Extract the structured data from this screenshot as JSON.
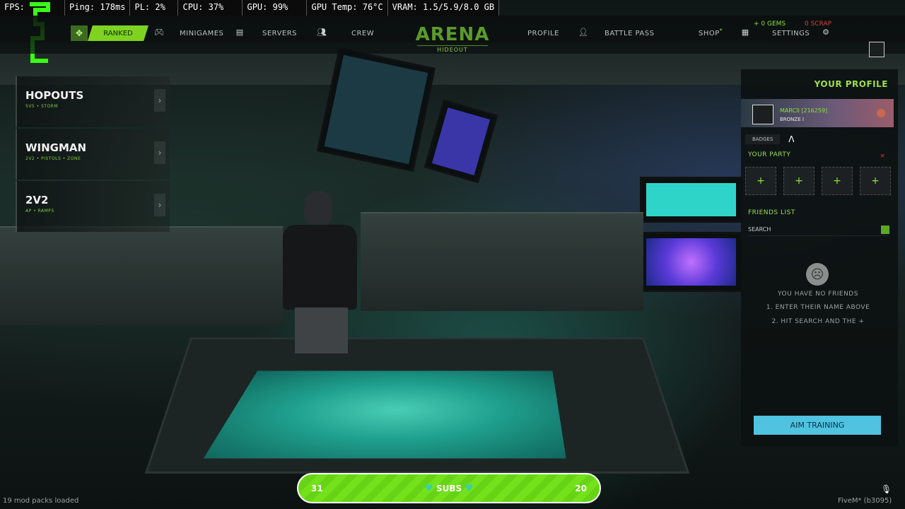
{
  "perf": {
    "fps": "FPS:",
    "ping": "Ping: 178ms",
    "pl": "PL: 2%",
    "cpu": "CPU: 37%",
    "gpu": "GPU: 99%",
    "gpu_temp": "GPU Temp: 76°C",
    "vram": "VRAM: 1.5/5.9/8.0 GB"
  },
  "nav": {
    "ranked": "RANKED",
    "minigames": "MINIGAMES",
    "servers": "SERVERS",
    "crew": "CREW",
    "profile": "PROFILE",
    "battle_pass": "BATTLE PASS",
    "shop": "SHOP",
    "shop_marker": "*",
    "settings": "SETTINGS"
  },
  "logo": {
    "title": "ARENA",
    "subtitle": "HIDEOUT"
  },
  "currency": {
    "gems": "+ 0 GEMS",
    "scrap": "0 SCRAP",
    "gems_color": "#8be33d",
    "scrap_color": "#c44"
  },
  "modes": [
    {
      "name": "HOPOUTS",
      "tags": "5V5 • STORM"
    },
    {
      "name": "WINGMAN",
      "tags": "2V2 • PISTOLS • ZONE"
    },
    {
      "name": "2V2",
      "tags": "AP • RAMPS"
    }
  ],
  "profile_panel": {
    "title": "YOUR PROFILE",
    "player_name": "MARCII [216259]",
    "rank": "BRONZE I",
    "badges_label": "BADGES",
    "party_title": "YOUR PARTY",
    "party_close": "×",
    "party_slots": [
      "+",
      "+",
      "+",
      "+"
    ],
    "friends_title": "FRIENDS LIST",
    "search_placeholder": "SEARCH",
    "empty_line1": "YOU HAVE NO FRIENDS",
    "empty_line2": "1. ENTER THEIR NAME ABOVE",
    "empty_line3": "2. HIT SEARCH AND THE +",
    "aim_training": "AIM TRAINING"
  },
  "subs": {
    "left": "31",
    "label": "SUBS",
    "right": "20"
  },
  "footer": {
    "left": "19 mod packs loaded",
    "right": "FiveM* (b3095)"
  },
  "colors": {
    "accent": "#7ed321",
    "panel_title": "#9be04a",
    "aim_button": "#4fc3e0"
  }
}
